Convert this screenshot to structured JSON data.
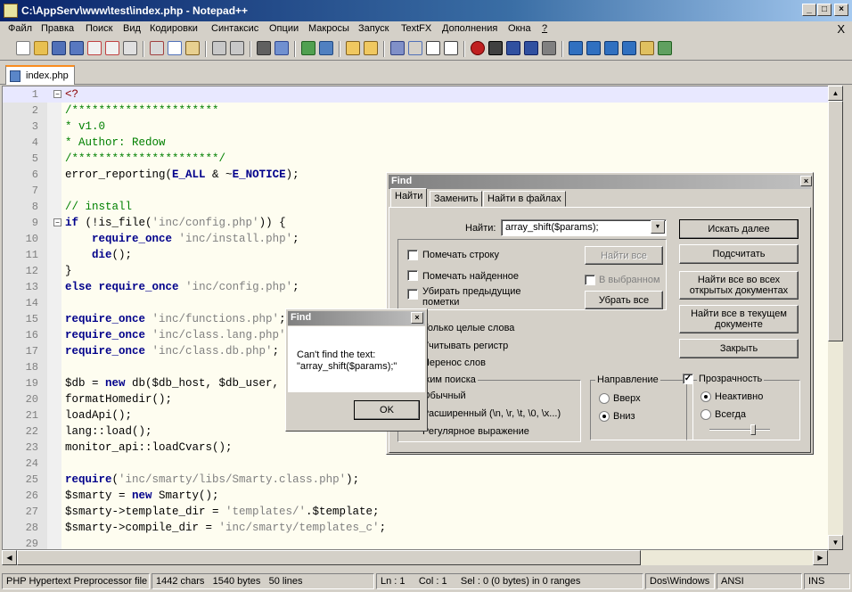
{
  "window": {
    "title": "C:\\AppServ\\www\\test\\index.php - Notepad++",
    "min": "_",
    "max": "□",
    "close": "×"
  },
  "menu": [
    "Файл",
    "Правка",
    "Поиск",
    "Вид",
    "Кодировки",
    "Синтаксис",
    "Опции",
    "Макросы",
    "Запуск",
    "TextFX",
    "Дополнения",
    "Окна",
    "?"
  ],
  "menu_close": "X",
  "tab": {
    "label": "index.php"
  },
  "code": {
    "lines": [
      {
        "n": "1",
        "html": "<span class=\"op\">&lt;?</span>"
      },
      {
        "n": "2",
        "html": "<span class=\"cm\">/**********************</span>"
      },
      {
        "n": "3",
        "html": "<span class=\"cm\">* v1.0</span>"
      },
      {
        "n": "4",
        "html": "<span class=\"cm\">* Author: Redow</span>"
      },
      {
        "n": "5",
        "html": "<span class=\"cm\">/**********************/</span>"
      },
      {
        "n": "6",
        "html": "error_reporting(<span class=\"kw\">E_ALL</span> &amp; ~<span class=\"kw\">E_NOTICE</span>);"
      },
      {
        "n": "7",
        "html": ""
      },
      {
        "n": "8",
        "html": "<span class=\"cm\">// install</span>"
      },
      {
        "n": "9",
        "html": "<span class=\"kw\">if</span> (!is_file(<span class=\"st\">'inc/config.php'</span>)) {"
      },
      {
        "n": "10",
        "html": "    <span class=\"kw\">require_once</span> <span class=\"st\">'inc/install.php'</span>;"
      },
      {
        "n": "11",
        "html": "    <span class=\"kw\">die</span>();"
      },
      {
        "n": "12",
        "html": "}"
      },
      {
        "n": "13",
        "html": "<span class=\"kw\">else</span> <span class=\"kw\">require_once</span> <span class=\"st\">'inc/config.php'</span>;"
      },
      {
        "n": "14",
        "html": ""
      },
      {
        "n": "15",
        "html": "<span class=\"kw\">require_once</span> <span class=\"st\">'inc/functions.php'</span>;"
      },
      {
        "n": "16",
        "html": "<span class=\"kw\">require_once</span> <span class=\"st\">'inc/class.lang.php'</span>;"
      },
      {
        "n": "17",
        "html": "<span class=\"kw\">require_once</span> <span class=\"st\">'inc/class.db.php'</span>;"
      },
      {
        "n": "18",
        "html": ""
      },
      {
        "n": "19",
        "html": "$db = <span class=\"kw\">new</span> db($db_host, $db_user, $db_pass, $db_name); <span class=\"cm\">// db($host, $username, $password, $name,$prefix,$p</span>"
      },
      {
        "n": "20",
        "html": "formatHomedir();"
      },
      {
        "n": "21",
        "html": "loadApi();"
      },
      {
        "n": "22",
        "html": "lang::load();"
      },
      {
        "n": "23",
        "html": "monitor_api::loadCvars();"
      },
      {
        "n": "24",
        "html": ""
      },
      {
        "n": "25",
        "html": "<span class=\"kw\">require</span>(<span class=\"st\">'inc/smarty/libs/Smarty.class.php'</span>);"
      },
      {
        "n": "26",
        "html": "$smarty = <span class=\"kw\">new</span> Smarty();"
      },
      {
        "n": "27",
        "html": "$smarty-&gt;template_dir = <span class=\"st\">'templates/'</span>.$template;"
      },
      {
        "n": "28",
        "html": "$smarty-&gt;compile_dir = <span class=\"st\">'inc/smarty/templates_c'</span>;"
      },
      {
        "n": "29",
        "html": ""
      }
    ]
  },
  "status": {
    "filetype": "PHP Hypertext Preprocessor file",
    "chars": "1442 chars",
    "bytes": "1540 bytes",
    "lines": "50 lines",
    "ln": "Ln : 1",
    "col": "Col : 1",
    "sel": "Sel : 0 (0 bytes) in 0 ranges",
    "eol": "Dos\\Windows",
    "encoding": "ANSI",
    "mode": "INS"
  },
  "find": {
    "title": "Find",
    "tabs": [
      "Найти",
      "Заменить",
      "Найти в файлах"
    ],
    "find_label": "Найти:",
    "find_value": "array_shift($params);",
    "mark_line": "Помечать строку",
    "mark_found": "Помечать найденное",
    "clear_prev": "Убирать предыдущие пометки",
    "in_selection": "В выбранном",
    "whole_word": "Только целые слова",
    "match_case": "Учитывать регистр",
    "wrap": "Перенос слов",
    "search_mode_label": "Режим поиска",
    "mode_normal": "Обычный",
    "mode_extended": "Расширенный (\\n, \\r, \\t, \\0, \\x...)",
    "mode_regex": "Регулярное выражение",
    "direction_label": "Направление",
    "dir_up": "Вверх",
    "dir_down": "Вниз",
    "transparency_label": "Прозрачность",
    "trans_inactive": "Неактивно",
    "trans_always": "Всегда",
    "btn_find_next": "Искать далее",
    "btn_count": "Подсчитать",
    "btn_find_all_open": "Найти все во всех открытых документах",
    "btn_find_all_current": "Найти все в текущем документе",
    "btn_close": "Закрыть",
    "btn_mark_all": "Найти все",
    "btn_clear_all": "Убрать все"
  },
  "msg": {
    "title": "Find",
    "line1": "Can't find the text:",
    "line2": "\"array_shift($params);\"",
    "ok": "OK"
  }
}
